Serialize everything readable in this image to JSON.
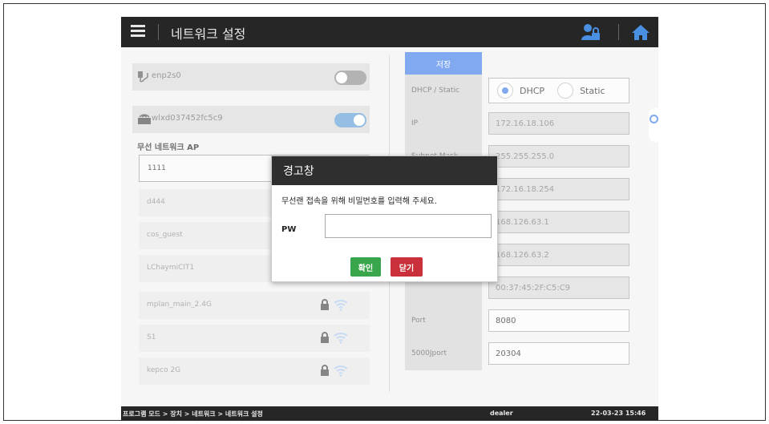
{
  "header": {
    "title": "네트워크 설정"
  },
  "left": {
    "wired": {
      "label": "enp2s0",
      "enabled": false
    },
    "wifi": {
      "label": "wlxd037452fc5c9",
      "enabled": true
    },
    "ap_title": "무선 네트워크 AP",
    "aps": [
      {
        "name": "1111",
        "selected": true
      },
      {
        "name": "d444"
      },
      {
        "name": "cos_guest"
      },
      {
        "name": "LChaymiCIT1"
      },
      {
        "name": "mplan_main_2.4G"
      },
      {
        "name": "S1"
      },
      {
        "name": "kepco 2G"
      }
    ]
  },
  "right": {
    "save_label": "저장",
    "rows": [
      {
        "label": "DHCP / Static",
        "dhcp": "DHCP",
        "static": "Static"
      },
      {
        "label": "IP",
        "value": "172.16.18.106"
      },
      {
        "label": "Subnet Mask",
        "value": "255.255.255.0"
      },
      {
        "label": "",
        "value": "172.16.18.254"
      },
      {
        "label": "",
        "value": "168.126.63.1"
      },
      {
        "label": "",
        "value": "168.126.63.2"
      },
      {
        "label": "",
        "value": "00:37:45:2F:C5:C9"
      },
      {
        "label": "Port",
        "value": "8080"
      },
      {
        "label": "5000Jport",
        "value": "20304"
      }
    ]
  },
  "dialog": {
    "title": "경고창",
    "message": "무선랜 접속을 위해 비밀번호를 입력해 주세요.",
    "pw_label": "PW",
    "pw_value": "",
    "ok_label": "확인",
    "close_label": "닫기"
  },
  "footer": {
    "breadcrumb": "프로그램 모드 > 장치 > 네트워크 > 네트워크 설정",
    "user": "dealer",
    "datetime": "22-03-23 15:46"
  },
  "colors": {
    "accent": "#3d7be8",
    "header_bg": "#262626",
    "ok": "#3aa64c",
    "close": "#c9303a",
    "toggle_on": "#5b9bd5",
    "wifi_icon": "#a9c8f0"
  },
  "icons": [
    "menu-icon",
    "user-lock-icon",
    "home-icon",
    "ethernet-icon",
    "wifi-dongle-icon",
    "lock-icon",
    "wifi-icon"
  ]
}
